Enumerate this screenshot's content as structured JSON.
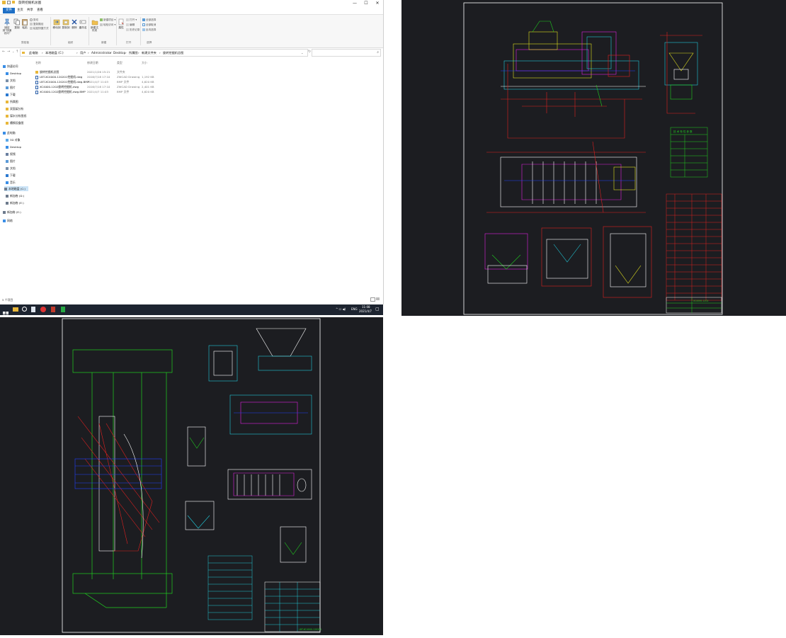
{
  "explorer": {
    "title": "旋转挖掘机总图",
    "window_controls": {
      "minimize": "—",
      "maximize": "☐",
      "close": "✕"
    },
    "tabs": [
      "文件",
      "主页",
      "共享",
      "查看"
    ],
    "ribbon": {
      "pin_label": "固定到\"快速访问\"",
      "copy_label": "复制",
      "paste_label": "粘贴",
      "cut_label": "剪切",
      "copy_path_label": "复制路径",
      "paste_shortcut_label": "粘贴快捷方式",
      "move_to_label": "移动到",
      "copy_to_label": "复制到",
      "delete_label": "删除",
      "rename_label": "重命名",
      "new_folder_label": "新建文件夹",
      "new_item_label": "新建项目",
      "easy_access_label": "轻松访问",
      "properties_label": "属性",
      "open_label": "打开",
      "edit_label": "编辑",
      "history_label": "历史记录",
      "select_all_label": "全部选择",
      "select_none_label": "全部取消",
      "invert_label": "反向选择",
      "groups": [
        "剪贴板",
        "组织",
        "新建",
        "打开",
        "选择"
      ]
    },
    "address": {
      "crumbs": [
        "此电脑",
        "本地磁盘 (C:)",
        "用户",
        "Administrator",
        "Desktop",
        "所属图",
        "新建文件夹",
        "旋转挖掘机总图"
      ],
      "search_placeholder": ""
    },
    "nav": {
      "quick_access": "快速访问",
      "items": [
        "Desktop",
        "文档",
        "图片",
        "下载",
        "所属图",
        "双面架分析",
        "煤水分析图纸",
        "槽钢设备图"
      ],
      "this_pc": "此电脑",
      "pc_items": [
        "3D 对象",
        "Desktop",
        "视频",
        "图片",
        "文档",
        "下载",
        "音乐",
        "本地磁盘 (C:)",
        "新加卷 (D:)",
        "新加卷 (E:)"
      ],
      "network_drive": "新加卷 (E:)",
      "network": "网络"
    },
    "columns": [
      "名称",
      "修改日期",
      "类型",
      "大小"
    ],
    "files": [
      {
        "name": "旋转挖掘机总图",
        "date": "2021/1/26 15:21",
        "type": "文件夹",
        "size": ""
      },
      {
        "name": "LBT-XC4000-120201挖掘机.dwg",
        "date": "2016/7/18 17:10",
        "type": "ZWCAD Drawing",
        "size": "1,192 KB"
      },
      {
        "name": "LBT-XC4000-120201挖掘机.dwg.BMP",
        "date": "2021/4/7 11:03",
        "type": "BMP 文件",
        "size": "4,620 KB"
      },
      {
        "name": "XC4000-1202旋转挖掘机.dwg",
        "date": "2016/7/18 17:10",
        "type": "ZWCAD Drawing",
        "size": "2,401 KB"
      },
      {
        "name": "XC4000-1202旋转挖掘机.dwg.BMP",
        "date": "2021/4/7 11:03",
        "type": "BMP 文件",
        "size": "4,620 KB"
      }
    ],
    "status": "5 个项目"
  },
  "taskbar": {
    "tray_lang": "ENG",
    "time": "11:08",
    "date": "2021/4/7",
    "tray_symbols": "^  ☐  ◀)"
  },
  "cad_top_right": {
    "title_block": "XC4000-1202",
    "parts_table_title": "技 术 特 性 参 数"
  },
  "cad_bottom_left": {
    "title_block": "LBT-XC4000-120201"
  },
  "colors": {
    "cad_background": "#1c1d21",
    "sheet_border": "#ffffff",
    "line_red": "#e02020",
    "line_green": "#20d020",
    "line_cyan": "#20c8d8",
    "line_magenta": "#e020e0",
    "line_yellow": "#e0e020",
    "line_blue": "#2040ff",
    "explorer_file_tab": "#1e6fc5",
    "taskbar": "#1d2430"
  }
}
